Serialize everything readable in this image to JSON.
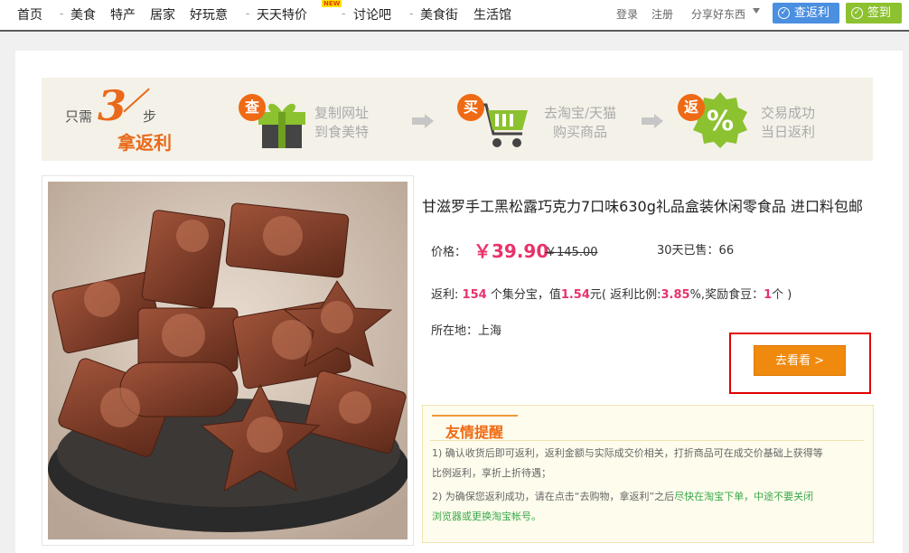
{
  "nav": {
    "items": [
      "首页",
      "美食",
      "特产",
      "居家",
      "好玩意",
      "天天特价",
      "讨论吧",
      "美食街",
      "生活馆"
    ],
    "new_badge": "NEW",
    "login": "登录",
    "register": "注册",
    "share": "分享好东西",
    "rebate_button": "查返利",
    "sign_button": "签到"
  },
  "steps": {
    "lead_a": "只需",
    "lead_num": "3",
    "lead_b": "步",
    "lead_c": "拿返利",
    "items": [
      {
        "badge": "查",
        "line1": "复制网址",
        "line2": "到食美特",
        "icon": "gift-box-icon"
      },
      {
        "badge": "买",
        "line1": "去淘宝/天猫",
        "line2": "购买商品",
        "icon": "shopping-cart-icon"
      },
      {
        "badge": "返",
        "line1": "交易成功",
        "line2": "当日返利",
        "icon": "percent-badge-icon"
      }
    ]
  },
  "product": {
    "title": "甘滋罗手工黑松露巧克力7口味630g礼品盒装休闲零食品 进口料包邮",
    "price_label": "价格：",
    "price": "￥39.90",
    "old_price": "￥145.00",
    "sold": "30天已售：66",
    "rebate": {
      "label": "返利:",
      "amount": "154",
      "t1": "个集分宝，值",
      "value": "1.54",
      "t2": "元( 返利比例:",
      "ratio": "3.85",
      "t3": "%,奖励食豆：",
      "beans": "1",
      "t4": "个 )"
    },
    "location": "所在地：上海",
    "go_button": "去看看 >"
  },
  "tips": {
    "title": "友情提醒",
    "line1": "1) 确认收货后即可返利，返利金额与实际成交价相关，打折商品可在成交价基础上获得等",
    "line1b": "比例返利，享折上折待遇；",
    "line2a": "2) 为确保您返利成功，请在点击“去购物，拿返利”之后",
    "line2b": "尽快在淘宝下单，中途不要关闭",
    "line2c": "浏览器或更换淘宝帐号。"
  },
  "colors": {
    "accent": "#e8336b",
    "orange": "#f08a0e",
    "blue": "#4a8fe0",
    "green": "#8cc130"
  }
}
